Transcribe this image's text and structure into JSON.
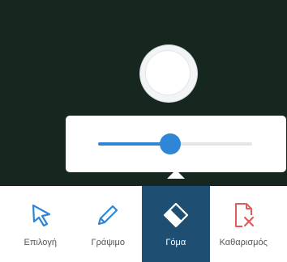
{
  "colors": {
    "board": "#15271f",
    "accent": "#2f86d6",
    "active_tool": "#1e4e71",
    "danger": "#e25a5a"
  },
  "eraser_size": {
    "value_fraction": 0.47
  },
  "toolbar": {
    "active": "eraser",
    "tools": [
      {
        "id": "select",
        "label": "Επιλογή",
        "icon": "cursor-arrow-icon"
      },
      {
        "id": "draw",
        "label": "Γράψιμο",
        "icon": "pencil-icon"
      },
      {
        "id": "eraser",
        "label": "Γόμα",
        "icon": "eraser-icon"
      },
      {
        "id": "clear",
        "label": "Καθαρισμός",
        "icon": "clear-page-icon"
      }
    ]
  }
}
